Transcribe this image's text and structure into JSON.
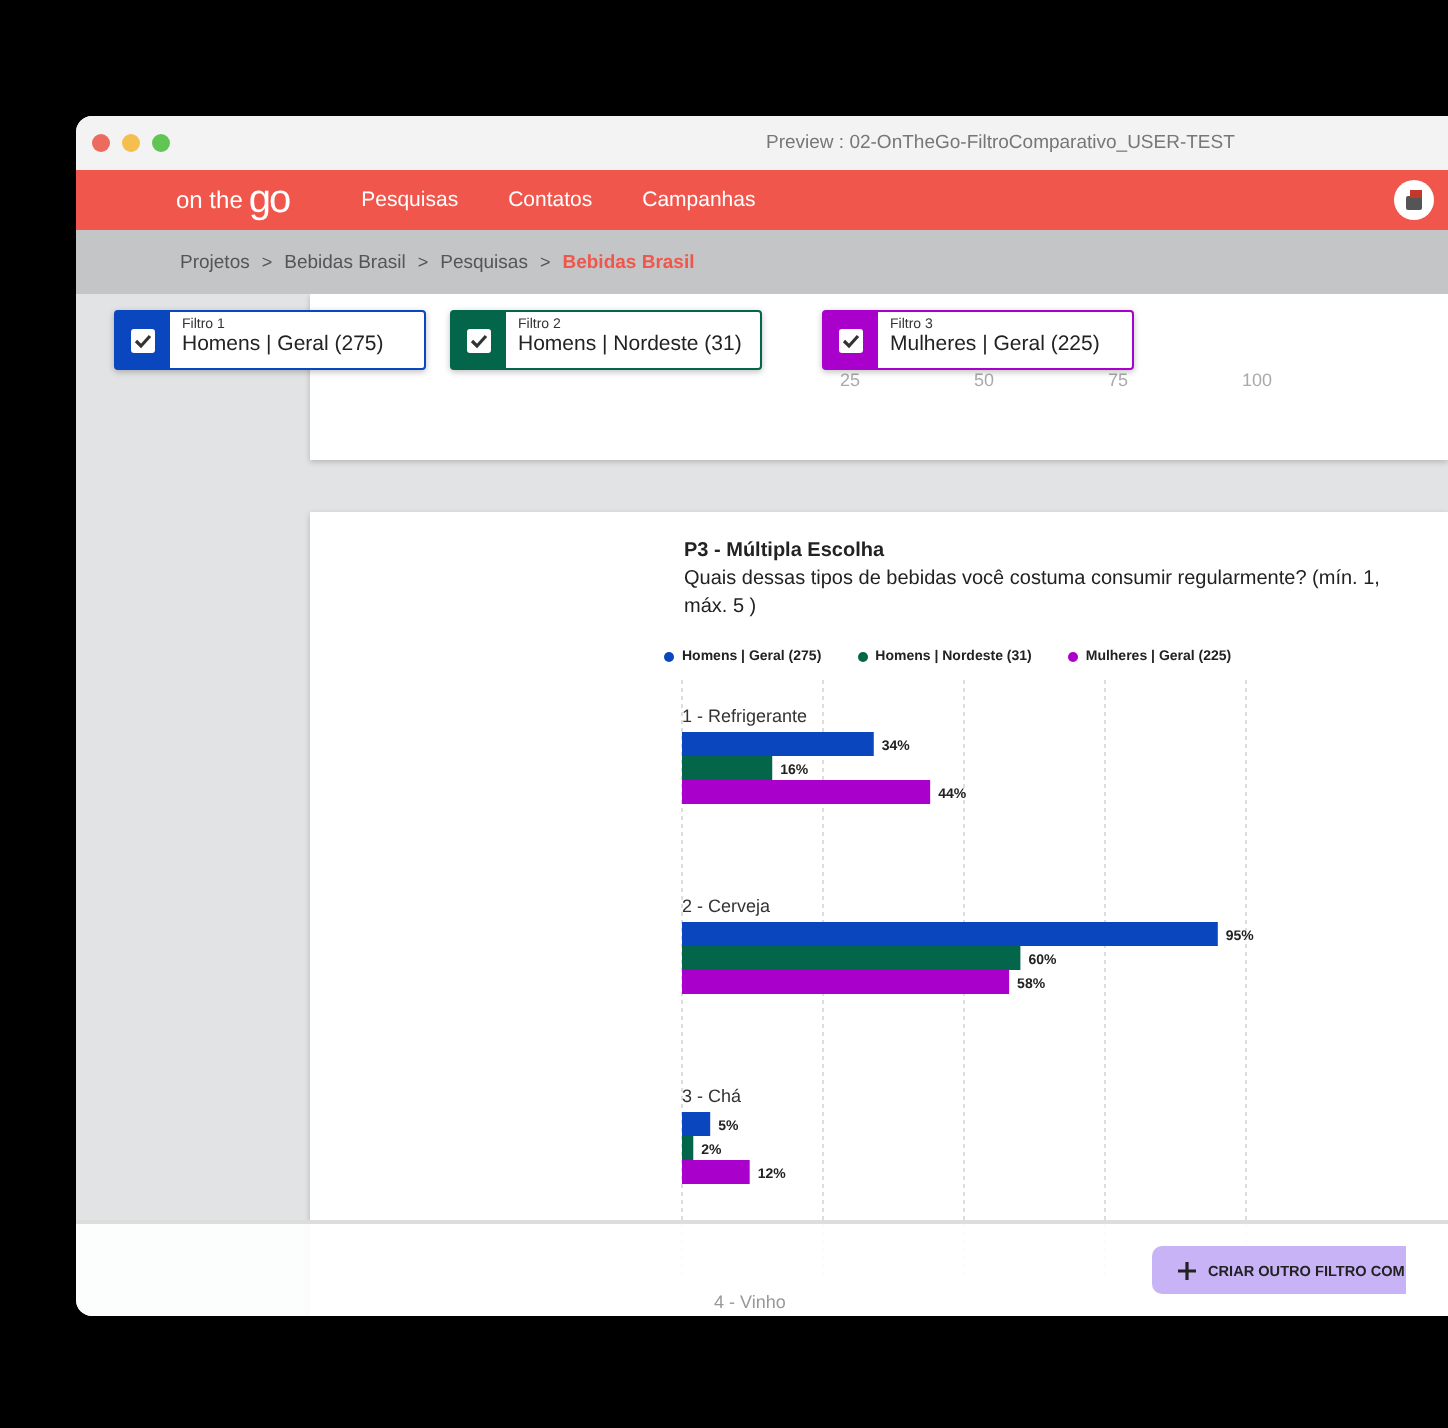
{
  "window": {
    "title": "Preview : 02-OnTheGo-FiltroComparativo_USER-TEST"
  },
  "nav": {
    "logo": {
      "prefix": "on the",
      "mark": "go"
    },
    "items": [
      {
        "label": "Pesquisas"
      },
      {
        "label": "Contatos"
      },
      {
        "label": "Campanhas"
      }
    ]
  },
  "breadcrumb": [
    {
      "label": "Projetos",
      "current": false
    },
    {
      "label": "Bebidas Brasil",
      "current": false
    },
    {
      "label": "Pesquisas",
      "current": false
    },
    {
      "label": "Bebidas Brasil",
      "current": true
    }
  ],
  "breadcrumb_separator": ">",
  "filters": [
    {
      "caption": "Filtro 1",
      "label": "Homens | Geral (275)",
      "checked": true,
      "color": "#0a46bd"
    },
    {
      "caption": "Filtro 2",
      "label": "Homens | Nordeste (31)",
      "checked": true,
      "color": "#03654a"
    },
    {
      "caption": "Filtro 3",
      "label": "Mulheres | Geral (225)",
      "checked": true,
      "color": "#aa00cc"
    }
  ],
  "previous_chart": {
    "ticks": [
      "25",
      "50",
      "75",
      "100"
    ]
  },
  "question": {
    "title": "P3 - Múltipla Escolha",
    "text": "Quais dessas tipos de bebidas você costuma consumir regularmente? (mín. 1, máx. 5 )",
    "chart_data": {
      "type": "bar",
      "orientation": "horizontal",
      "categories": [
        "1 - Refrigerante",
        "2 - Cerveja",
        "3 - Chá"
      ],
      "series": [
        {
          "name": "Homens | Geral (275)",
          "color": "#0a46bd",
          "values": [
            34,
            95,
            5
          ],
          "value_labels": [
            "34%",
            "95%",
            "5%"
          ]
        },
        {
          "name": "Homens | Nordeste (31)",
          "color": "#03654a",
          "values": [
            16,
            60,
            2
          ],
          "value_labels": [
            "16%",
            "60%",
            "2%"
          ]
        },
        {
          "name": "Mulheres | Geral (225)",
          "color": "#aa00cc",
          "values": [
            44,
            58,
            12
          ],
          "value_labels": [
            "44%",
            "58%",
            "12%"
          ]
        }
      ]
    },
    "next_category": "4 - Vinho"
  },
  "footer": {
    "button": "CRIAR OUTRO FILTRO COM"
  }
}
